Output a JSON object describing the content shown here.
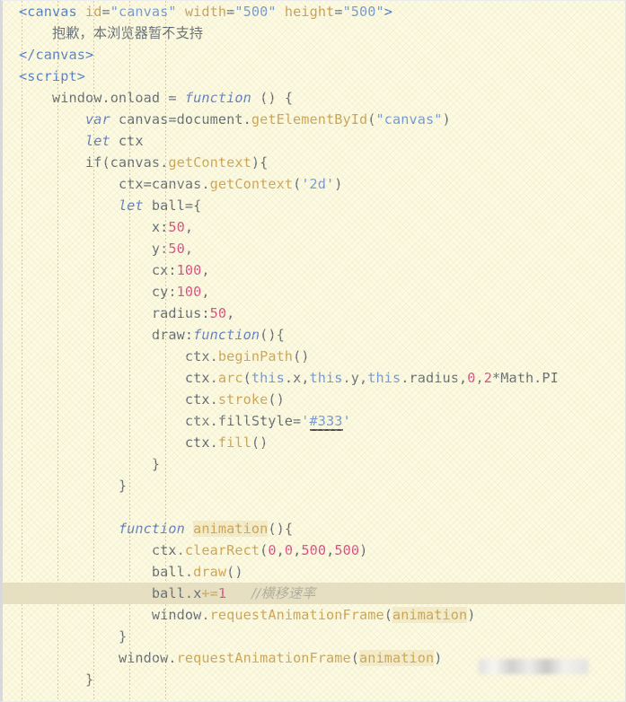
{
  "editor": {
    "background_color": "#fdfae4",
    "default_text_color": "#5c6670",
    "highlight_row_color": "#e7dfc4",
    "language": "html-javascript",
    "font": "monospace",
    "line_height_px": 24
  },
  "palette": {
    "tag": "#4a78c8",
    "attribute": "#c89a50",
    "string": "#6a94d4",
    "keyword": "#5878c0",
    "function": "#c8a050",
    "number": "#d6467e",
    "comment": "#a9a9a0"
  },
  "code": {
    "lines": [
      {
        "n": 1,
        "indent": 0,
        "tokens": [
          {
            "t": "<canvas ",
            "c": "tag"
          },
          {
            "t": "id",
            "c": "attr"
          },
          {
            "t": "=",
            "c": "plain"
          },
          {
            "t": "\"canvas\"",
            "c": "str"
          },
          {
            "t": " ",
            "c": "plain"
          },
          {
            "t": "width",
            "c": "attr"
          },
          {
            "t": "=",
            "c": "plain"
          },
          {
            "t": "\"500\"",
            "c": "str"
          },
          {
            "t": " ",
            "c": "plain"
          },
          {
            "t": "height",
            "c": "attr"
          },
          {
            "t": "=",
            "c": "plain"
          },
          {
            "t": "\"500\"",
            "c": "str"
          },
          {
            "t": ">",
            "c": "tag"
          }
        ]
      },
      {
        "n": 2,
        "indent": 1,
        "tokens": [
          {
            "t": "抱歉，本浏览器暂不支持",
            "c": "cn"
          }
        ]
      },
      {
        "n": 3,
        "indent": 0,
        "tokens": [
          {
            "t": "</canvas>",
            "c": "tag"
          }
        ]
      },
      {
        "n": 4,
        "indent": 0,
        "tokens": [
          {
            "t": "<script>",
            "c": "tag"
          }
        ]
      },
      {
        "n": 5,
        "indent": 1,
        "tokens": [
          {
            "t": "window.onload = ",
            "c": "plain"
          },
          {
            "t": "function",
            "c": "kw"
          },
          {
            "t": " () {",
            "c": "plain"
          }
        ]
      },
      {
        "n": 6,
        "indent": 2,
        "tokens": [
          {
            "t": "var",
            "c": "kw"
          },
          {
            "t": " canvas=document.",
            "c": "plain"
          },
          {
            "t": "getElementById",
            "c": "fn"
          },
          {
            "t": "(",
            "c": "plain"
          },
          {
            "t": "\"canvas\"",
            "c": "str"
          },
          {
            "t": ")",
            "c": "plain"
          }
        ]
      },
      {
        "n": 7,
        "indent": 2,
        "tokens": [
          {
            "t": "let",
            "c": "kw"
          },
          {
            "t": " ctx",
            "c": "plain"
          }
        ]
      },
      {
        "n": 8,
        "indent": 2,
        "tokens": [
          {
            "t": "if(canvas.",
            "c": "plain"
          },
          {
            "t": "getContext",
            "c": "fn"
          },
          {
            "t": "){",
            "c": "plain"
          }
        ]
      },
      {
        "n": 9,
        "indent": 3,
        "tokens": [
          {
            "t": "ctx=canvas.",
            "c": "plain"
          },
          {
            "t": "getContext",
            "c": "fn"
          },
          {
            "t": "(",
            "c": "plain"
          },
          {
            "t": "'2d'",
            "c": "str"
          },
          {
            "t": ")",
            "c": "plain"
          }
        ]
      },
      {
        "n": 10,
        "indent": 3,
        "tokens": [
          {
            "t": "let",
            "c": "kw"
          },
          {
            "t": " ball={",
            "c": "plain"
          }
        ]
      },
      {
        "n": 11,
        "indent": 4,
        "tokens": [
          {
            "t": "x:",
            "c": "plain"
          },
          {
            "t": "50",
            "c": "num"
          },
          {
            "t": ",",
            "c": "plain"
          }
        ]
      },
      {
        "n": 12,
        "indent": 4,
        "tokens": [
          {
            "t": "y:",
            "c": "plain"
          },
          {
            "t": "50",
            "c": "num"
          },
          {
            "t": ",",
            "c": "plain"
          }
        ]
      },
      {
        "n": 13,
        "indent": 4,
        "tokens": [
          {
            "t": "cx:",
            "c": "plain"
          },
          {
            "t": "100",
            "c": "num"
          },
          {
            "t": ",",
            "c": "plain"
          }
        ]
      },
      {
        "n": 14,
        "indent": 4,
        "tokens": [
          {
            "t": "cy:",
            "c": "plain"
          },
          {
            "t": "100",
            "c": "num"
          },
          {
            "t": ",",
            "c": "plain"
          }
        ]
      },
      {
        "n": 15,
        "indent": 4,
        "tokens": [
          {
            "t": "radius:",
            "c": "plain"
          },
          {
            "t": "50",
            "c": "num"
          },
          {
            "t": ",",
            "c": "plain"
          }
        ]
      },
      {
        "n": 16,
        "indent": 4,
        "tokens": [
          {
            "t": "draw:",
            "c": "plain"
          },
          {
            "t": "function",
            "c": "kw"
          },
          {
            "t": "(){",
            "c": "plain"
          }
        ]
      },
      {
        "n": 17,
        "indent": 5,
        "tokens": [
          {
            "t": "ctx.",
            "c": "plain"
          },
          {
            "t": "beginPath",
            "c": "fn"
          },
          {
            "t": "()",
            "c": "plain"
          }
        ]
      },
      {
        "n": 18,
        "indent": 5,
        "tokens": [
          {
            "t": "ctx.",
            "c": "plain"
          },
          {
            "t": "arc",
            "c": "fn"
          },
          {
            "t": "(",
            "c": "plain"
          },
          {
            "t": "this",
            "c": "this"
          },
          {
            "t": ".x,",
            "c": "plain"
          },
          {
            "t": "this",
            "c": "this"
          },
          {
            "t": ".y,",
            "c": "plain"
          },
          {
            "t": "this",
            "c": "this"
          },
          {
            "t": ".radius,",
            "c": "plain"
          },
          {
            "t": "0",
            "c": "num"
          },
          {
            "t": ",",
            "c": "plain"
          },
          {
            "t": "2",
            "c": "num"
          },
          {
            "t": "*Math.PI",
            "c": "plain"
          }
        ]
      },
      {
        "n": 19,
        "indent": 5,
        "tokens": [
          {
            "t": "ctx.",
            "c": "plain"
          },
          {
            "t": "stroke",
            "c": "fn"
          },
          {
            "t": "()",
            "c": "plain"
          }
        ]
      },
      {
        "n": 20,
        "indent": 5,
        "tokens": [
          {
            "t": "ctx.fillStyle=",
            "c": "plain"
          },
          {
            "t": "'",
            "c": "str"
          },
          {
            "t": "#333",
            "c": "colorsw"
          },
          {
            "t": "'",
            "c": "str"
          }
        ]
      },
      {
        "n": 21,
        "indent": 5,
        "tokens": [
          {
            "t": "ctx.",
            "c": "plain"
          },
          {
            "t": "fill",
            "c": "fn"
          },
          {
            "t": "()",
            "c": "plain"
          }
        ]
      },
      {
        "n": 22,
        "indent": 4,
        "tokens": [
          {
            "t": "}",
            "c": "plain"
          }
        ]
      },
      {
        "n": 23,
        "indent": 3,
        "tokens": [
          {
            "t": "}",
            "c": "plain"
          }
        ]
      },
      {
        "n": 24,
        "indent": 0,
        "tokens": []
      },
      {
        "n": 25,
        "indent": 3,
        "tokens": [
          {
            "t": "function",
            "c": "kw"
          },
          {
            "t": " ",
            "c": "plain"
          },
          {
            "t": "animation",
            "c": "fnhl"
          },
          {
            "t": "(){",
            "c": "plain"
          }
        ]
      },
      {
        "n": 26,
        "indent": 4,
        "tokens": [
          {
            "t": "ctx.",
            "c": "plain"
          },
          {
            "t": "clearRect",
            "c": "fn"
          },
          {
            "t": "(",
            "c": "plain"
          },
          {
            "t": "0",
            "c": "num"
          },
          {
            "t": ",",
            "c": "plain"
          },
          {
            "t": "0",
            "c": "num"
          },
          {
            "t": ",",
            "c": "plain"
          },
          {
            "t": "500",
            "c": "num"
          },
          {
            "t": ",",
            "c": "plain"
          },
          {
            "t": "500",
            "c": "num"
          },
          {
            "t": ")",
            "c": "plain"
          }
        ]
      },
      {
        "n": 27,
        "indent": 4,
        "tokens": [
          {
            "t": "ball.",
            "c": "plain"
          },
          {
            "t": "draw",
            "c": "fn"
          },
          {
            "t": "()",
            "c": "plain"
          }
        ]
      },
      {
        "n": 28,
        "indent": 4,
        "highlight": true,
        "tokens": [
          {
            "t": "ball.x",
            "c": "plain"
          },
          {
            "t": "+=",
            "c": "op"
          },
          {
            "t": "1",
            "c": "num"
          },
          {
            "t": "   ",
            "c": "plain"
          },
          {
            "t": "//横移速率",
            "c": "comment"
          }
        ]
      },
      {
        "n": 29,
        "indent": 4,
        "tokens": [
          {
            "t": "window.",
            "c": "plain"
          },
          {
            "t": "requestAnimationFrame",
            "c": "fn"
          },
          {
            "t": "(",
            "c": "plain"
          },
          {
            "t": "animation",
            "c": "fnhl"
          },
          {
            "t": ")",
            "c": "plain"
          }
        ]
      },
      {
        "n": 30,
        "indent": 3,
        "tokens": [
          {
            "t": "}",
            "c": "plain"
          }
        ]
      },
      {
        "n": 31,
        "indent": 3,
        "tokens": [
          {
            "t": "window.",
            "c": "plain"
          },
          {
            "t": "requestAnimationFrame",
            "c": "fn"
          },
          {
            "t": "(",
            "c": "plain"
          },
          {
            "t": "animation",
            "c": "fnhl"
          },
          {
            "t": ")",
            "c": "plain"
          }
        ]
      },
      {
        "n": 32,
        "indent": 2,
        "tokens": [
          {
            "t": "}",
            "c": "plain"
          }
        ]
      }
    ]
  },
  "redaction": {
    "present": true,
    "description": "blurred-gray-smear"
  }
}
